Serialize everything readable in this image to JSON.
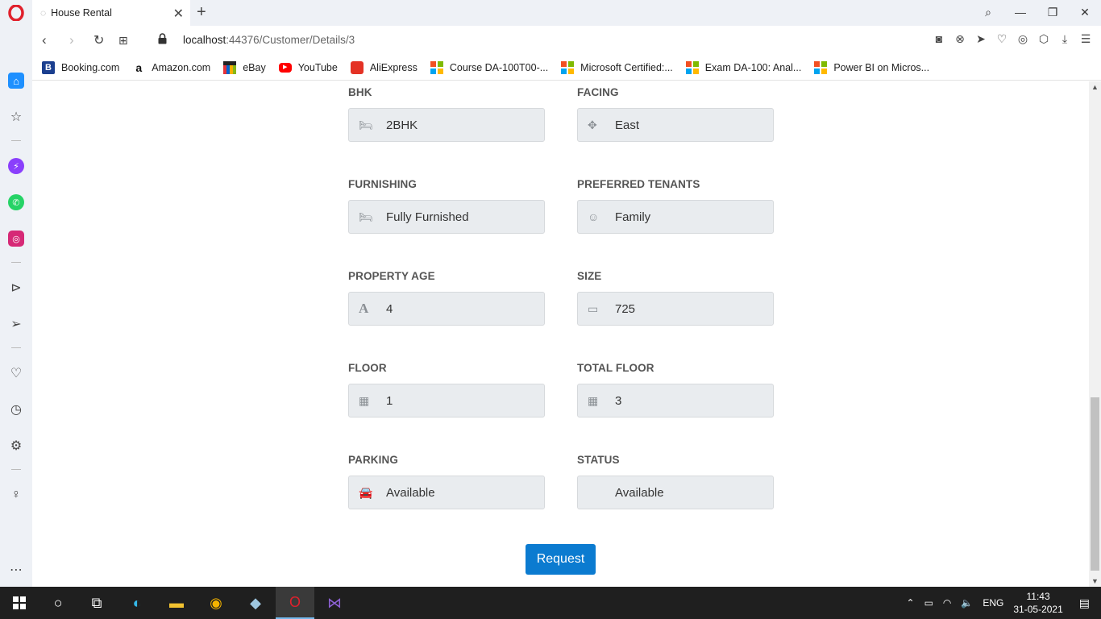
{
  "browser": {
    "tab_title": "House Rental",
    "url_host": "localhost",
    "url_path": ":44376/Customer/Details/3"
  },
  "bookmarks": [
    {
      "label": "Booking.com",
      "icon": "booking-icon"
    },
    {
      "label": "Amazon.com",
      "icon": "amazon-icon"
    },
    {
      "label": "eBay",
      "icon": "ebay-icon"
    },
    {
      "label": "YouTube",
      "icon": "youtube-icon"
    },
    {
      "label": "AliExpress",
      "icon": "aliexpress-icon"
    },
    {
      "label": "Course DA-100T00-...",
      "icon": "microsoft-icon"
    },
    {
      "label": "Microsoft Certified:...",
      "icon": "microsoft-icon"
    },
    {
      "label": "Exam DA-100: Anal...",
      "icon": "microsoft-icon"
    },
    {
      "label": "Power BI on Micros...",
      "icon": "microsoft-icon"
    }
  ],
  "details": {
    "bhk": {
      "label": "BHK",
      "value": "2BHK",
      "icon": "bed-icon"
    },
    "facing": {
      "label": "FACING",
      "value": "East",
      "icon": "arrows-icon"
    },
    "furnishing": {
      "label": "FURNISHING",
      "value": "Fully Furnished",
      "icon": "bed-icon"
    },
    "preferred_tenants": {
      "label": "PREFERRED TENANTS",
      "value": "Family",
      "icon": "face-icon"
    },
    "property_age": {
      "label": "PROPERTY AGE",
      "value": "4",
      "icon": "letter-a-icon"
    },
    "size": {
      "label": "SIZE",
      "value": "725",
      "icon": "ruler-icon"
    },
    "floor": {
      "label": "FLOOR",
      "value": "1",
      "icon": "building-icon"
    },
    "total_floor": {
      "label": "TOTAL FLOOR",
      "value": "3",
      "icon": "building-icon"
    },
    "parking": {
      "label": "PARKING",
      "value": "Available",
      "icon": "car-icon"
    },
    "status": {
      "label": "STATUS",
      "value": "Available",
      "icon": ""
    }
  },
  "request_button": "Request",
  "taskbar": {
    "language": "ENG",
    "time": "11:43",
    "date": "31-05-2021"
  }
}
